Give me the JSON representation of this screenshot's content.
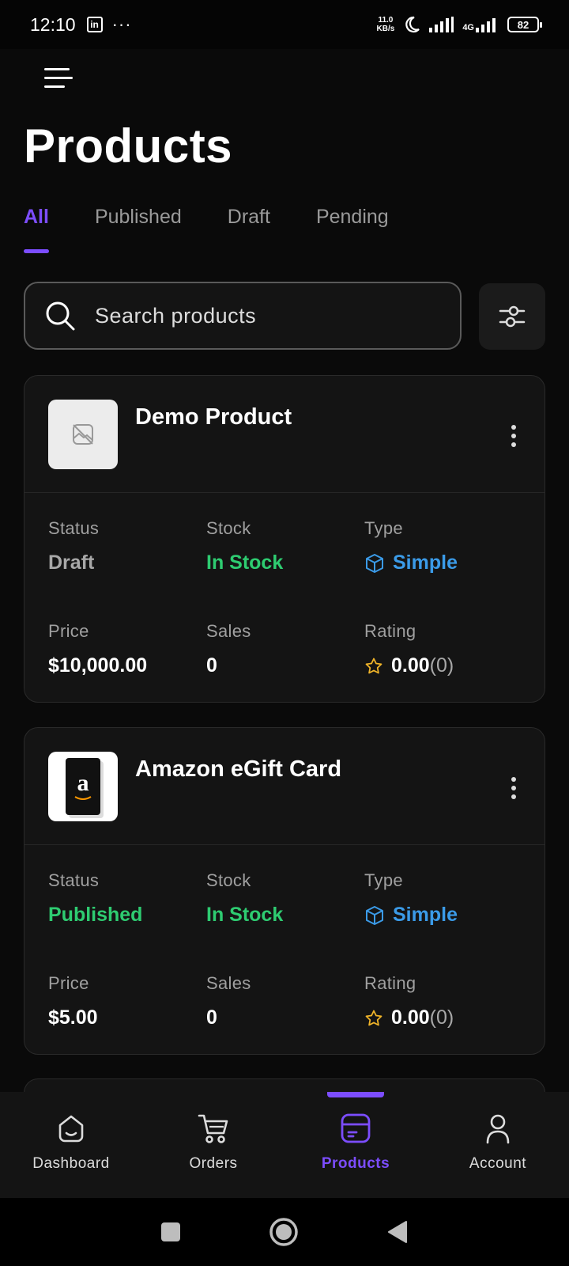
{
  "status_bar": {
    "time": "12:10",
    "app_badge": "in",
    "dots": "···",
    "net_speed_value": "11.0",
    "net_speed_unit": "KB/s",
    "network": "4G",
    "battery": "82"
  },
  "page_title": "Products",
  "tabs": [
    {
      "label": "All",
      "active": true
    },
    {
      "label": "Published",
      "active": false
    },
    {
      "label": "Draft",
      "active": false
    },
    {
      "label": "Pending",
      "active": false
    }
  ],
  "search": {
    "placeholder": "Search products"
  },
  "products": [
    {
      "name": "Demo Product",
      "thumbnail": "image-placeholder-icon",
      "status_label": "Status",
      "status": "Draft",
      "stock_label": "Stock",
      "stock": "In Stock",
      "type_label": "Type",
      "type": "Simple",
      "price_label": "Price",
      "price": "$10,000.00",
      "sales_label": "Sales",
      "sales": "0",
      "rating_label": "Rating",
      "rating": "0.00",
      "rating_count": "(0)"
    },
    {
      "name": "Amazon eGift Card",
      "thumbnail": "amazon-gift-card-image",
      "thumbnail_letter": "a",
      "status_label": "Status",
      "status": "Published",
      "stock_label": "Stock",
      "stock": "In Stock",
      "type_label": "Type",
      "type": "Simple",
      "price_label": "Price",
      "price": "$5.00",
      "sales_label": "Sales",
      "sales": "0",
      "rating_label": "Rating",
      "rating": "0.00",
      "rating_count": "(0)"
    }
  ],
  "bottom_nav": [
    {
      "label": "Dashboard",
      "icon": "home-icon",
      "active": false
    },
    {
      "label": "Orders",
      "icon": "cart-icon",
      "active": false
    },
    {
      "label": "Products",
      "icon": "box-icon",
      "active": true
    },
    {
      "label": "Account",
      "icon": "user-icon",
      "active": false
    }
  ],
  "colors": {
    "accent": "#7c4dff",
    "published": "#2ecc71",
    "type": "#3b9be8",
    "star": "#f0b429",
    "background": "#0a0a0a",
    "card": "#141414"
  }
}
